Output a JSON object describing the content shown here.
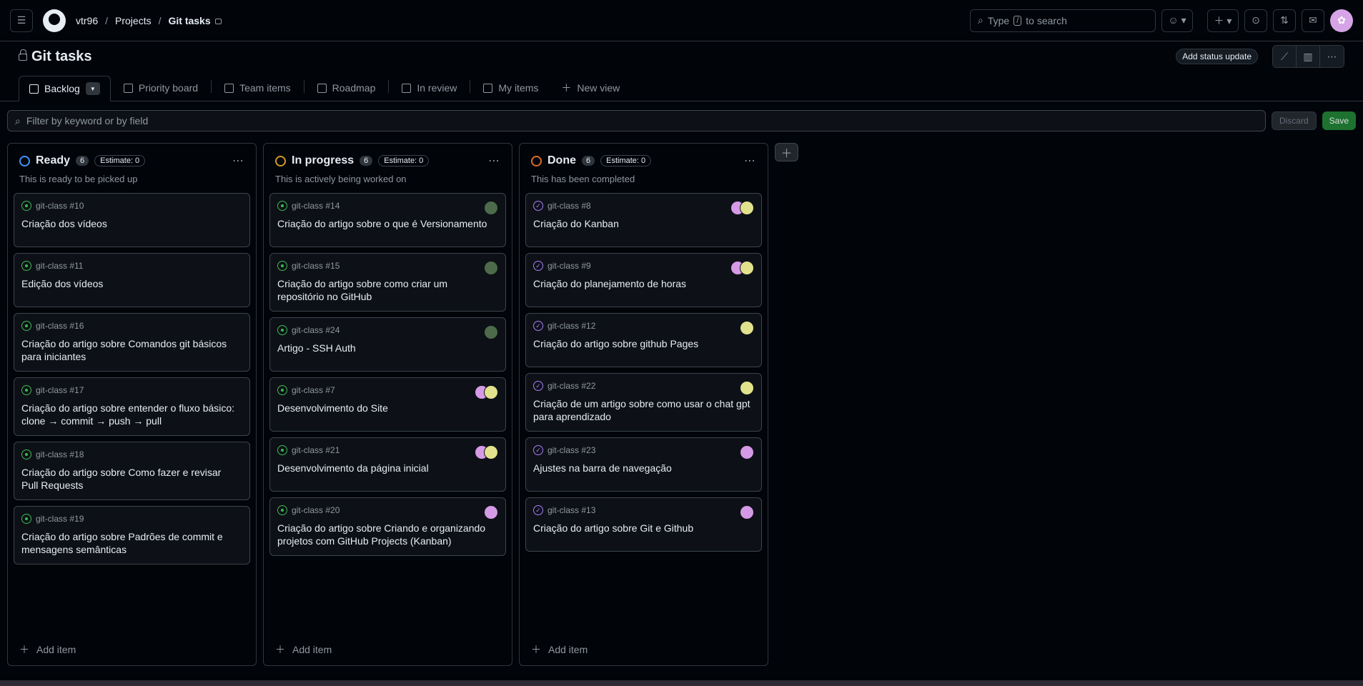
{
  "topbar": {
    "breadcrumb": [
      "vtr96",
      "Projects",
      "Git tasks"
    ],
    "search_prefix": "Type",
    "search_key": "/",
    "search_suffix": "to search"
  },
  "project": {
    "title": "Git tasks",
    "status_update": "Add status update"
  },
  "tabs": [
    {
      "label": "Backlog",
      "active": true
    },
    {
      "label": "Priority board"
    },
    {
      "label": "Team items"
    },
    {
      "label": "Roadmap"
    },
    {
      "label": "In review"
    },
    {
      "label": "My items"
    },
    {
      "label": "New view"
    }
  ],
  "filter": {
    "placeholder": "Filter by keyword or by field",
    "discard": "Discard",
    "save": "Save"
  },
  "columns": [
    {
      "name": "Ready",
      "count": "6",
      "estimate": "Estimate: 0",
      "description": "This is ready to be picked up",
      "color": "#4493f8",
      "add_item": "Add item",
      "cards": [
        {
          "ref": "git-class #10",
          "title": "Criação dos vídeos"
        },
        {
          "ref": "git-class #11",
          "title": "Edição dos vídeos"
        },
        {
          "ref": "git-class #16",
          "title": "Criação do artigo sobre Comandos git básicos para iniciantes"
        },
        {
          "ref": "git-class #17",
          "title": "Criação do artigo sobre entender o fluxo básico: clone → commit → push → pull"
        },
        {
          "ref": "git-class #18",
          "title": "Criação do artigo sobre Como fazer e revisar Pull Requests"
        },
        {
          "ref": "git-class #19",
          "title": "Criação do artigo sobre Padrões de commit e mensagens semânticas"
        }
      ]
    },
    {
      "name": "In progress",
      "count": "6",
      "estimate": "Estimate: 0",
      "description": "This is actively being worked on",
      "color": "#d29922",
      "add_item": "Add item",
      "cards": [
        {
          "ref": "git-class #14",
          "title": "Criação do artigo sobre o que é Versionamento"
        },
        {
          "ref": "git-class #15",
          "title": "Criação do artigo sobre como criar um repositório no GitHub"
        },
        {
          "ref": "git-class #24",
          "title": "Artigo - SSH Auth"
        },
        {
          "ref": "git-class #7",
          "title": "Desenvolvimento do Site"
        },
        {
          "ref": "git-class #21",
          "title": "Desenvolvimento da página inicial"
        },
        {
          "ref": "git-class #20",
          "title": "Criação do artigo sobre Criando e organizando projetos com GitHub Projects (Kanban)"
        }
      ]
    },
    {
      "name": "Done",
      "count": "6",
      "estimate": "Estimate: 0",
      "description": "This has been completed",
      "color": "#db6d28",
      "add_item": "Add item",
      "cards": [
        {
          "ref": "git-class #8",
          "title": "Criação do Kanban"
        },
        {
          "ref": "git-class #9",
          "title": "Criação do planejamento de horas"
        },
        {
          "ref": "git-class #12",
          "title": "Criação do artigo sobre github Pages"
        },
        {
          "ref": "git-class #22",
          "title": "Criação de um artigo sobre como usar o chat gpt para aprendizado"
        },
        {
          "ref": "git-class #23",
          "title": "Ajustes na barra de navegação"
        },
        {
          "ref": "git-class #13",
          "title": "Criação do artigo sobre Git e Github"
        }
      ]
    }
  ]
}
